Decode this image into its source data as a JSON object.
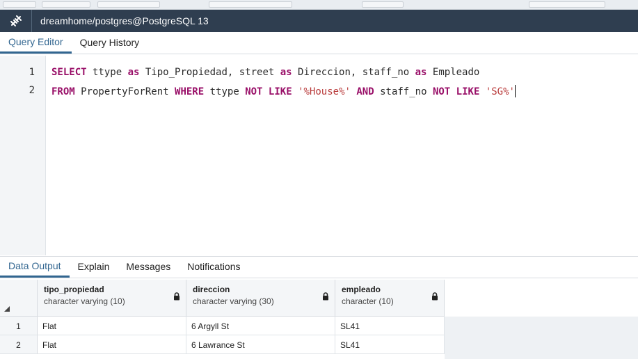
{
  "window": {
    "title": "dreamhome/postgres@PostgreSQL 13"
  },
  "editor_tabs": [
    {
      "label": "Query Editor",
      "active": true
    },
    {
      "label": "Query History",
      "active": false
    }
  ],
  "editor": {
    "line_numbers": [
      "1",
      "2"
    ],
    "line1": {
      "k1": "SELECT",
      "t1": " ttype ",
      "k2": "as",
      "t2": " Tipo_Propiedad, street ",
      "k3": "as",
      "t3": " Direccion, staff_no ",
      "k4": "as",
      "t4": " Empleado"
    },
    "line2": {
      "k1": "FROM",
      "t1": " PropertyForRent ",
      "k2": "WHERE",
      "t2": " ttype ",
      "k3": "NOT LIKE",
      "t3": " ",
      "s1": "'%House%'",
      "t4": " ",
      "k4": "AND",
      "t5": " staff_no ",
      "k5": "NOT LIKE",
      "t6": " ",
      "s2": "'SG%'"
    }
  },
  "result_tabs": [
    {
      "label": "Data Output",
      "active": true
    },
    {
      "label": "Explain",
      "active": false
    },
    {
      "label": "Messages",
      "active": false
    },
    {
      "label": "Notifications",
      "active": false
    }
  ],
  "grid": {
    "columns": [
      {
        "name": "tipo_propiedad",
        "type": "character varying (10)"
      },
      {
        "name": "direccion",
        "type": "character varying (30)"
      },
      {
        "name": "empleado",
        "type": "character (10)"
      }
    ],
    "rows": [
      {
        "num": "1",
        "cells": [
          "Flat",
          "6 Argyll St",
          "SL41"
        ]
      },
      {
        "num": "2",
        "cells": [
          "Flat",
          "6 Lawrance St",
          "SL41"
        ]
      }
    ]
  },
  "colors": {
    "titlebar": "#2f3e50",
    "accent": "#326690",
    "keyword": "#990f68",
    "string": "#b93b3b"
  },
  "icons": {
    "connection": "connection-plug-icon",
    "lock": "lock-icon",
    "sort": "sort-corner-icon"
  }
}
